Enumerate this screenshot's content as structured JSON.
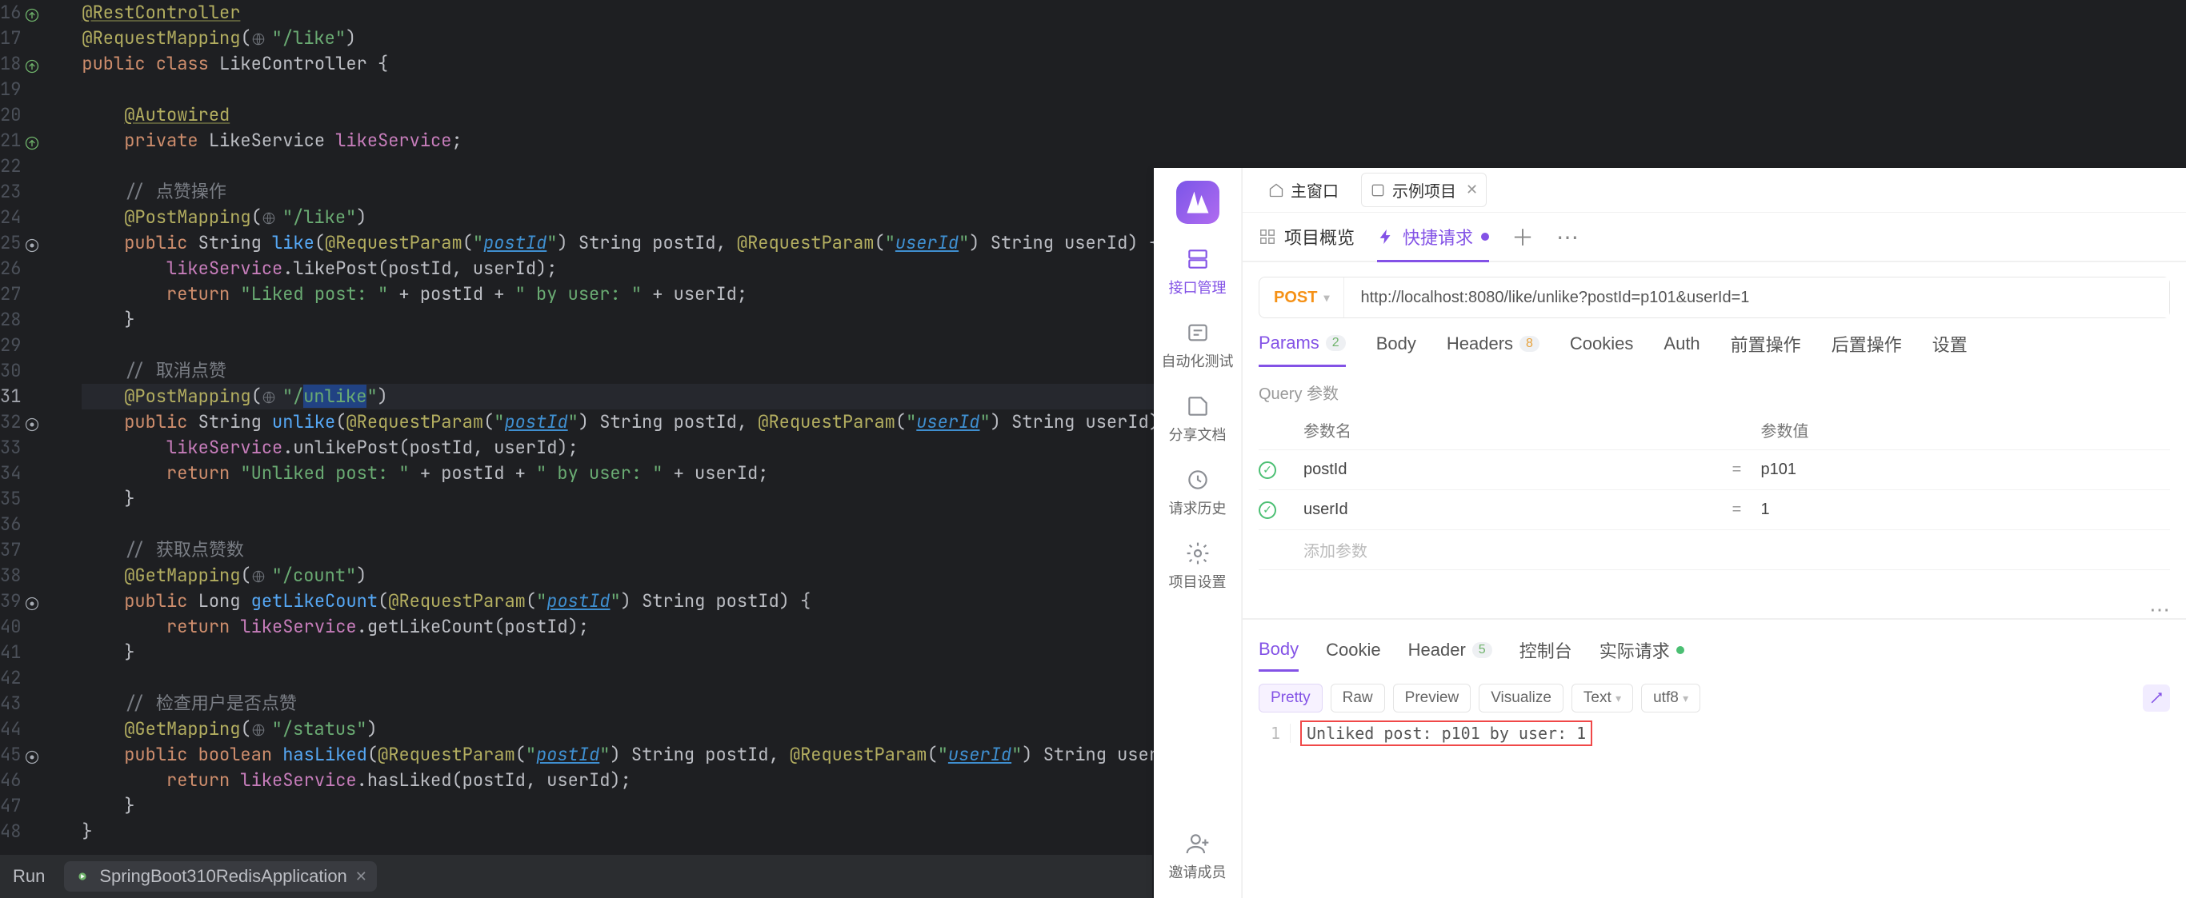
{
  "editor": {
    "first_line_number": 16,
    "current_line": 31,
    "lines": [
      {
        "n": 16,
        "mark": "green-up",
        "segs": [
          {
            "t": "@RestController",
            "c": "tok-ann-hl"
          }
        ]
      },
      {
        "n": 17,
        "segs": [
          {
            "t": "@RequestMapping",
            "c": "tok-ann"
          },
          {
            "t": "(",
            "c": "tok-ident"
          },
          {
            "t": "GLOBE",
            "c": "globe"
          },
          {
            "t": "\"/like\"",
            "c": "tok-str"
          },
          {
            "t": ")",
            "c": "tok-ident"
          }
        ]
      },
      {
        "n": 18,
        "mark": "green-up",
        "segs": [
          {
            "t": "public class ",
            "c": "tok-kw"
          },
          {
            "t": "LikeController {",
            "c": "tok-class"
          }
        ]
      },
      {
        "n": 19,
        "segs": []
      },
      {
        "n": 20,
        "segs": [
          {
            "t": "    ",
            "c": ""
          },
          {
            "t": "@Autowired",
            "c": "tok-ann-hl"
          }
        ]
      },
      {
        "n": 21,
        "mark": "green-up",
        "segs": [
          {
            "t": "    ",
            "c": ""
          },
          {
            "t": "private ",
            "c": "tok-kw"
          },
          {
            "t": "LikeService ",
            "c": "tok-class"
          },
          {
            "t": "likeService",
            "c": "tok-field"
          },
          {
            "t": ";",
            "c": "tok-ident"
          }
        ]
      },
      {
        "n": 22,
        "segs": []
      },
      {
        "n": 23,
        "segs": [
          {
            "t": "    ",
            "c": ""
          },
          {
            "t": "// 点赞操作",
            "c": "tok-cmnt"
          }
        ]
      },
      {
        "n": 24,
        "segs": [
          {
            "t": "    ",
            "c": ""
          },
          {
            "t": "@PostMapping",
            "c": "tok-ann"
          },
          {
            "t": "(",
            "c": "tok-ident"
          },
          {
            "t": "GLOBE",
            "c": "globe"
          },
          {
            "t": "\"/like\"",
            "c": "tok-str"
          },
          {
            "t": ")",
            "c": "tok-ident"
          }
        ]
      },
      {
        "n": 25,
        "mark": "route",
        "segs": [
          {
            "t": "    ",
            "c": ""
          },
          {
            "t": "public ",
            "c": "tok-kw"
          },
          {
            "t": "String ",
            "c": "tok-class"
          },
          {
            "t": "like",
            "c": "tok-func-def"
          },
          {
            "t": "(",
            "c": "tok-ident"
          },
          {
            "t": "@RequestParam",
            "c": "tok-ann"
          },
          {
            "t": "(",
            "c": "tok-ident"
          },
          {
            "t": "\"",
            "c": "tok-str"
          },
          {
            "t": "postId",
            "c": "tok-param"
          },
          {
            "t": "\"",
            "c": "tok-str"
          },
          {
            "t": ") String postId, ",
            "c": "tok-ident"
          },
          {
            "t": "@RequestParam",
            "c": "tok-ann"
          },
          {
            "t": "(",
            "c": "tok-ident"
          },
          {
            "t": "\"",
            "c": "tok-str"
          },
          {
            "t": "userId",
            "c": "tok-param"
          },
          {
            "t": "\"",
            "c": "tok-str"
          },
          {
            "t": ") String userId) {",
            "c": "tok-ident"
          }
        ]
      },
      {
        "n": 26,
        "segs": [
          {
            "t": "        ",
            "c": ""
          },
          {
            "t": "likeService",
            "c": "tok-field"
          },
          {
            "t": ".likePost(postId, userId);",
            "c": "tok-ident"
          }
        ]
      },
      {
        "n": 27,
        "segs": [
          {
            "t": "        ",
            "c": ""
          },
          {
            "t": "return ",
            "c": "tok-kw"
          },
          {
            "t": "\"Liked post: \"",
            "c": "tok-str"
          },
          {
            "t": " + postId + ",
            "c": "tok-ident"
          },
          {
            "t": "\" by user: \"",
            "c": "tok-str"
          },
          {
            "t": " + userId;",
            "c": "tok-ident"
          }
        ]
      },
      {
        "n": 28,
        "segs": [
          {
            "t": "    }",
            "c": "tok-ident"
          }
        ]
      },
      {
        "n": 29,
        "segs": []
      },
      {
        "n": 30,
        "segs": [
          {
            "t": "    ",
            "c": ""
          },
          {
            "t": "// 取消点赞",
            "c": "tok-cmnt"
          }
        ]
      },
      {
        "n": 31,
        "hl": true,
        "segs": [
          {
            "t": "    ",
            "c": ""
          },
          {
            "t": "@PostMapping",
            "c": "tok-ann"
          },
          {
            "t": "(",
            "c": "tok-ident"
          },
          {
            "t": "GLOBE",
            "c": "globe"
          },
          {
            "t": "\"/",
            "c": "tok-str"
          },
          {
            "t": "unlike",
            "c": "tok-str sel"
          },
          {
            "t": "\"",
            "c": "tok-str"
          },
          {
            "t": ")",
            "c": "tok-ident"
          }
        ]
      },
      {
        "n": 32,
        "mark": "route",
        "segs": [
          {
            "t": "    ",
            "c": ""
          },
          {
            "t": "public ",
            "c": "tok-kw"
          },
          {
            "t": "String ",
            "c": "tok-class"
          },
          {
            "t": "unlike",
            "c": "tok-func-def"
          },
          {
            "t": "(",
            "c": "tok-ident"
          },
          {
            "t": "@RequestParam",
            "c": "tok-ann"
          },
          {
            "t": "(",
            "c": "tok-ident"
          },
          {
            "t": "\"",
            "c": "tok-str"
          },
          {
            "t": "postId",
            "c": "tok-param"
          },
          {
            "t": "\"",
            "c": "tok-str"
          },
          {
            "t": ") String postId, ",
            "c": "tok-ident"
          },
          {
            "t": "@RequestParam",
            "c": "tok-ann"
          },
          {
            "t": "(",
            "c": "tok-ident"
          },
          {
            "t": "\"",
            "c": "tok-str"
          },
          {
            "t": "userId",
            "c": "tok-param"
          },
          {
            "t": "\"",
            "c": "tok-str"
          },
          {
            "t": ") String userId) {",
            "c": "tok-ident"
          }
        ]
      },
      {
        "n": 33,
        "segs": [
          {
            "t": "        ",
            "c": ""
          },
          {
            "t": "likeService",
            "c": "tok-field"
          },
          {
            "t": ".unlikePost(postId, userId);",
            "c": "tok-ident"
          }
        ]
      },
      {
        "n": 34,
        "segs": [
          {
            "t": "        ",
            "c": ""
          },
          {
            "t": "return ",
            "c": "tok-kw"
          },
          {
            "t": "\"Unliked post: \"",
            "c": "tok-str"
          },
          {
            "t": " + postId + ",
            "c": "tok-ident"
          },
          {
            "t": "\" by user: \"",
            "c": "tok-str"
          },
          {
            "t": " + userId;",
            "c": "tok-ident"
          }
        ]
      },
      {
        "n": 35,
        "segs": [
          {
            "t": "    }",
            "c": "tok-ident"
          }
        ]
      },
      {
        "n": 36,
        "segs": []
      },
      {
        "n": 37,
        "segs": [
          {
            "t": "    ",
            "c": ""
          },
          {
            "t": "// 获取点赞数",
            "c": "tok-cmnt"
          }
        ]
      },
      {
        "n": 38,
        "segs": [
          {
            "t": "    ",
            "c": ""
          },
          {
            "t": "@GetMapping",
            "c": "tok-ann"
          },
          {
            "t": "(",
            "c": "tok-ident"
          },
          {
            "t": "GLOBE",
            "c": "globe"
          },
          {
            "t": "\"/count\"",
            "c": "tok-str"
          },
          {
            "t": ")",
            "c": "tok-ident"
          }
        ]
      },
      {
        "n": 39,
        "mark": "route",
        "segs": [
          {
            "t": "    ",
            "c": ""
          },
          {
            "t": "public ",
            "c": "tok-kw"
          },
          {
            "t": "Long ",
            "c": "tok-class"
          },
          {
            "t": "getLikeCount",
            "c": "tok-func-def"
          },
          {
            "t": "(",
            "c": "tok-ident"
          },
          {
            "t": "@RequestParam",
            "c": "tok-ann"
          },
          {
            "t": "(",
            "c": "tok-ident"
          },
          {
            "t": "\"",
            "c": "tok-str"
          },
          {
            "t": "postId",
            "c": "tok-param"
          },
          {
            "t": "\"",
            "c": "tok-str"
          },
          {
            "t": ") String postId) {",
            "c": "tok-ident"
          }
        ]
      },
      {
        "n": 40,
        "segs": [
          {
            "t": "        ",
            "c": ""
          },
          {
            "t": "return ",
            "c": "tok-kw"
          },
          {
            "t": "likeService",
            "c": "tok-field"
          },
          {
            "t": ".getLikeCount(postId);",
            "c": "tok-ident"
          }
        ]
      },
      {
        "n": 41,
        "segs": [
          {
            "t": "    }",
            "c": "tok-ident"
          }
        ]
      },
      {
        "n": 42,
        "segs": []
      },
      {
        "n": 43,
        "segs": [
          {
            "t": "    ",
            "c": ""
          },
          {
            "t": "// 检查用户是否点赞",
            "c": "tok-cmnt"
          }
        ]
      },
      {
        "n": 44,
        "segs": [
          {
            "t": "    ",
            "c": ""
          },
          {
            "t": "@GetMapping",
            "c": "tok-ann"
          },
          {
            "t": "(",
            "c": "tok-ident"
          },
          {
            "t": "GLOBE",
            "c": "globe"
          },
          {
            "t": "\"/status\"",
            "c": "tok-str"
          },
          {
            "t": ")",
            "c": "tok-ident"
          }
        ]
      },
      {
        "n": 45,
        "mark": "route",
        "segs": [
          {
            "t": "    ",
            "c": ""
          },
          {
            "t": "public boolean ",
            "c": "tok-kw"
          },
          {
            "t": "hasLiked",
            "c": "tok-func-def"
          },
          {
            "t": "(",
            "c": "tok-ident"
          },
          {
            "t": "@RequestParam",
            "c": "tok-ann"
          },
          {
            "t": "(",
            "c": "tok-ident"
          },
          {
            "t": "\"",
            "c": "tok-str"
          },
          {
            "t": "postId",
            "c": "tok-param"
          },
          {
            "t": "\"",
            "c": "tok-str"
          },
          {
            "t": ") String postId, ",
            "c": "tok-ident"
          },
          {
            "t": "@RequestParam",
            "c": "tok-ann"
          },
          {
            "t": "(",
            "c": "tok-ident"
          },
          {
            "t": "\"",
            "c": "tok-str"
          },
          {
            "t": "userId",
            "c": "tok-param"
          },
          {
            "t": "\"",
            "c": "tok-str"
          },
          {
            "t": ") String userId) {",
            "c": "tok-ident"
          }
        ]
      },
      {
        "n": 46,
        "segs": [
          {
            "t": "        ",
            "c": ""
          },
          {
            "t": "return ",
            "c": "tok-kw"
          },
          {
            "t": "likeService",
            "c": "tok-field"
          },
          {
            "t": ".hasLiked(postId, userId);",
            "c": "tok-ident"
          }
        ]
      },
      {
        "n": 47,
        "segs": [
          {
            "t": "    }",
            "c": "tok-ident"
          }
        ]
      },
      {
        "n": 48,
        "segs": [
          {
            "t": "}",
            "c": "tok-ident"
          }
        ]
      }
    ]
  },
  "runbar": {
    "label": "Run",
    "tab_name": "SpringBoot310RedisApplication"
  },
  "api": {
    "topbar": {
      "main_window": "主窗口",
      "example_project": "示例项目"
    },
    "sidebar": {
      "items": [
        "接口管理",
        "自动化测试",
        "分享文档",
        "请求历史",
        "项目设置"
      ],
      "invite": "邀请成员"
    },
    "tabs": {
      "overview": "项目概览",
      "quick": "快捷请求"
    },
    "url": {
      "method": "POST",
      "value": "http://localhost:8080/like/unlike?postId=p101&userId=1"
    },
    "req_tabs": {
      "params": "Params",
      "params_badge": "2",
      "body": "Body",
      "headers": "Headers",
      "headers_badge": "8",
      "cookies": "Cookies",
      "auth": "Auth",
      "pre": "前置操作",
      "post": "后置操作",
      "settings": "设置"
    },
    "query_section": "Query 参数",
    "param_table": {
      "col_name": "参数名",
      "col_value": "参数值",
      "rows": [
        {
          "name": "postId",
          "value": "p101"
        },
        {
          "name": "userId",
          "value": "1"
        }
      ],
      "add_placeholder": "添加参数"
    },
    "resp_tabs": {
      "body": "Body",
      "cookie": "Cookie",
      "header": "Header",
      "header_badge": "5",
      "console": "控制台",
      "actual": "实际请求"
    },
    "resp_toolbar": {
      "pretty": "Pretty",
      "raw": "Raw",
      "preview": "Preview",
      "visualize": "Visualize",
      "type": "Text",
      "encoding": "utf8"
    },
    "resp_body": {
      "line_no": "1",
      "text": "Unliked post: p101 by user: 1"
    }
  }
}
